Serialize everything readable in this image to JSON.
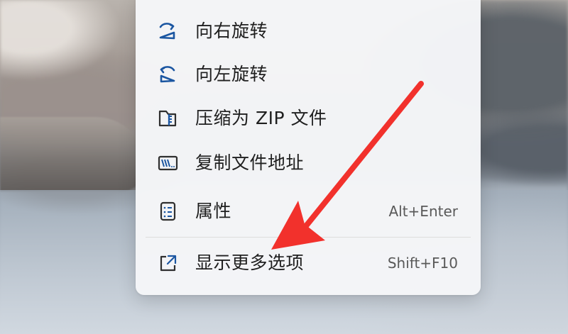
{
  "colors": {
    "menu_background": "#f4f5f7",
    "icon_blue": "#1b56a1",
    "text_primary": "#1f1f1f",
    "text_secondary": "#595959",
    "annotation_red": "#f2312c"
  },
  "context_menu": {
    "items": [
      {
        "label": "向右旋转",
        "icon": "rotate-right-icon"
      },
      {
        "label": "向左旋转",
        "icon": "rotate-left-icon"
      },
      {
        "label": "压缩为 ZIP 文件",
        "icon": "zip-folder-icon"
      },
      {
        "label": "复制文件地址",
        "icon": "copy-path-icon"
      },
      {
        "label": "属性",
        "shortcut": "Alt+Enter",
        "icon": "properties-icon"
      },
      {
        "label": "显示更多选项",
        "shortcut": "Shift+F10",
        "icon": "open-external-icon"
      }
    ]
  },
  "annotation": {
    "type": "red-arrow",
    "target": "显示更多选项"
  }
}
